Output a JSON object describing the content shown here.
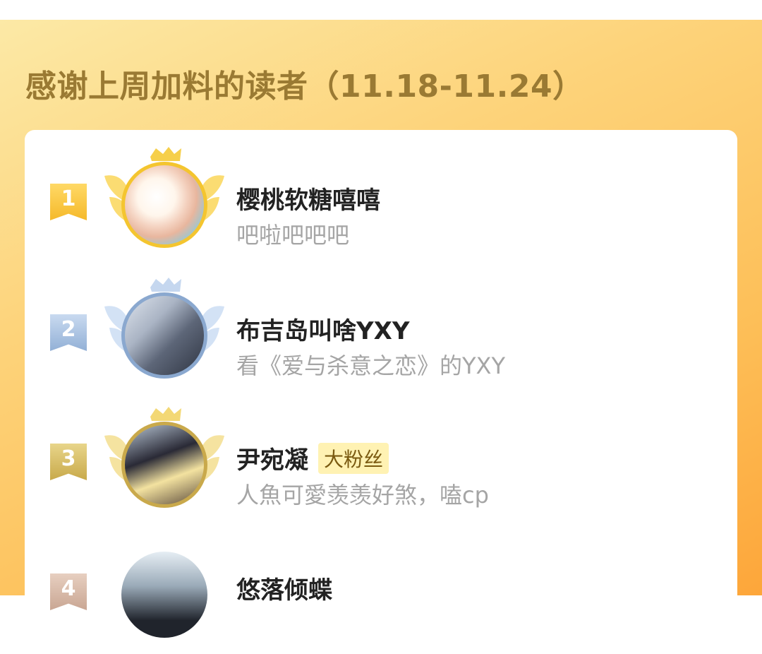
{
  "header": {
    "title": "感谢上周加料的读者（11.18-11.24）"
  },
  "colors": {
    "gold": "#f4c52f",
    "silver": "#8aa8cf",
    "bronze": "#c9a94b",
    "fourth": "#cfa98f",
    "title": "#9a7a33"
  },
  "readers": [
    {
      "rank": "1",
      "name": "樱桃软糖嘻嘻",
      "tag": "",
      "desc": "吧啦吧吧吧",
      "avatar_icon": "avatar-image"
    },
    {
      "rank": "2",
      "name": "布吉岛叫啥YXY",
      "tag": "",
      "desc": "看《爱与杀意之恋》的YXY",
      "avatar_icon": "avatar-image"
    },
    {
      "rank": "3",
      "name": "尹宛凝",
      "tag": "大粉丝",
      "desc": "人魚可愛羡羡好煞，嗑cp",
      "avatar_icon": "avatar-image"
    },
    {
      "rank": "4",
      "name": "悠落倾蝶",
      "tag": "",
      "desc": "",
      "avatar_icon": "avatar-image"
    }
  ]
}
